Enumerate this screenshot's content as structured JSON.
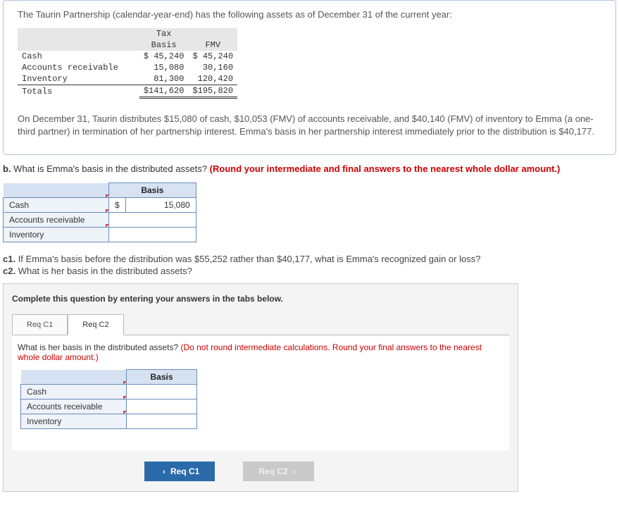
{
  "intro": "The Taurin Partnership (calendar-year-end) has the following assets as of December 31 of the current year:",
  "assets_table": {
    "hdr_tax": "Tax",
    "hdr_basis": "Basis",
    "hdr_fmv": "FMV",
    "rows": [
      {
        "label": "Cash",
        "basis": "$ 45,240",
        "fmv": "$ 45,240"
      },
      {
        "label": "Accounts receivable",
        "basis": "15,080",
        "fmv": "30,160"
      },
      {
        "label": "Inventory",
        "basis": "81,300",
        "fmv": "120,420"
      }
    ],
    "totals_label": "Totals",
    "totals_basis": "$141,620",
    "totals_fmv": "$195,820"
  },
  "para": "On December 31, Taurin distributes $15,080 of cash, $10,053 (FMV) of accounts receivable, and $40,140 (FMV) of inventory to Emma (a one-third partner) in termination of her partnership interest. Emma's basis in her partnership interest immediately prior to the distribution is $40,177.",
  "partB": {
    "prefix": "b.",
    "q": " What is Emma's basis in the distributed assets? ",
    "note": "(Round your intermediate and final answers to the nearest whole dollar amount.)",
    "basis_hdr": "Basis",
    "rows": [
      {
        "label": "Cash",
        "sym": "$",
        "val": "15,080"
      },
      {
        "label": "Accounts receivable",
        "sym": "",
        "val": ""
      },
      {
        "label": "Inventory",
        "sym": "",
        "val": ""
      }
    ]
  },
  "partC": {
    "c1_prefix": "c1.",
    "c1": " If Emma's basis before the distribution was $55,252 rather than $40,177, what is Emma's recognized gain or loss?",
    "c2_prefix": "c2.",
    "c2": " What is her basis in the distributed assets?",
    "instr": "Complete this question by entering your answers in the tabs below.",
    "tab1": "Req C1",
    "tab2": "Req C2",
    "body_q": "What is her basis in the distributed assets? ",
    "body_note": "(Do not round intermediate calculations. Round your final answers to the nearest whole dollar amount.)",
    "basis_hdr": "Basis",
    "rows": [
      {
        "label": "Cash"
      },
      {
        "label": "Accounts receivable"
      },
      {
        "label": "Inventory"
      }
    ],
    "prev": "Req C1",
    "next": "Req C2"
  }
}
